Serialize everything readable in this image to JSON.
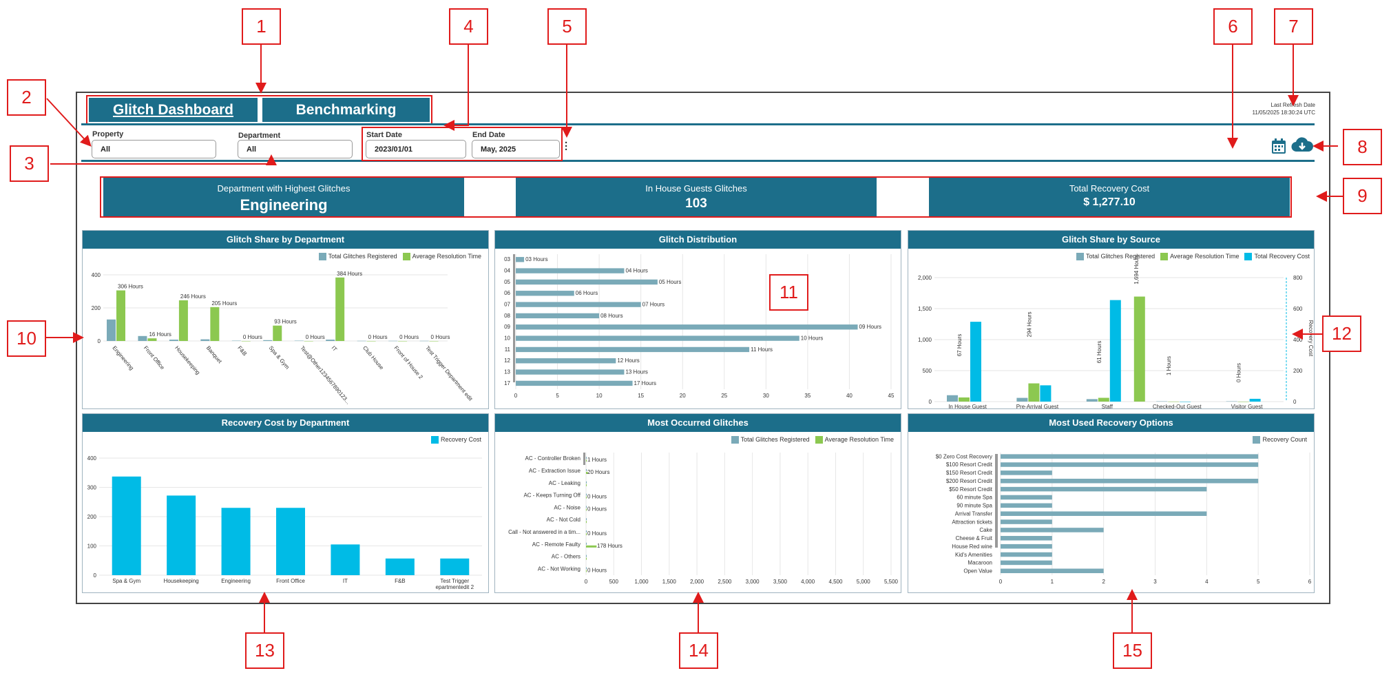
{
  "tabs": {
    "glitch_dashboard": "Glitch Dashboard",
    "benchmarking": "Benchmarking"
  },
  "filters": {
    "property_label": "Property",
    "property_value": "All",
    "department_label": "Department",
    "department_value": "All",
    "start_label": "Start Date",
    "start_value": "2023/01/01",
    "end_label": "End Date",
    "end_value": "May, 2025"
  },
  "refresh": {
    "label": "Last Refresh Date",
    "value": "11/05/2025 18:30:24 UTC"
  },
  "icons": {
    "calendar": "calendar-icon",
    "download": "cloud-download-icon",
    "more": "kebab-menu-icon"
  },
  "kpis": [
    {
      "title": "Department with Highest Glitches",
      "value": "Engineering"
    },
    {
      "title": "In House Guests Glitches",
      "value": "103"
    },
    {
      "title": "Total Recovery Cost",
      "value": "$ 1,277.10"
    }
  ],
  "callouts": [
    "1",
    "2",
    "3",
    "4",
    "5",
    "6",
    "7",
    "8",
    "9",
    "10",
    "11",
    "12",
    "13",
    "14",
    "15"
  ],
  "colors": {
    "header": "#1c6e8a",
    "series_total": "#7aaab8",
    "series_avg": "#8cc850",
    "series_cost": "#00bbe6",
    "callout": "#e01b1b"
  },
  "panels": {
    "dept_share": "Glitch Share by Department",
    "distribution": "Glitch Distribution",
    "source_share": "Glitch Share by Source",
    "recovery_cost": "Recovery Cost by Department",
    "most_occurred": "Most Occurred Glitches",
    "recovery_options": "Most Used Recovery Options"
  },
  "chart_data": [
    {
      "type": "bar",
      "title": "Glitch Share by Department",
      "categories": [
        "Engineering",
        "Front Office",
        "Housekeeping",
        "Banquet",
        "F&B",
        "Spa & Gym",
        "Test@Other1234567890123...",
        "IT",
        "Club House",
        "Front of House 2",
        "Test Trigger Department edit"
      ],
      "series": [
        {
          "name": "Total Glitches Registered",
          "values": [
            130,
            30,
            8,
            10,
            2,
            5,
            2,
            8,
            1,
            1,
            1
          ]
        },
        {
          "name": "Average Resolution Time",
          "values": [
            306,
            16,
            246,
            205,
            0,
            93,
            0,
            384,
            0,
            0,
            0
          ]
        }
      ],
      "data_labels": [
        "306 Hours",
        "16 Hours",
        "246 Hours",
        "205 Hours",
        "0 Hours",
        "93 Hours",
        "0 Hours",
        "384 Hours",
        "0 Hours",
        "0 Hours",
        "0 Hours"
      ],
      "ylim": [
        0,
        400
      ],
      "yticks": [
        "0",
        "200",
        "400"
      ],
      "legend": "top-right"
    },
    {
      "type": "bar",
      "orientation": "horizontal",
      "title": "Glitch Distribution",
      "categories": [
        "03",
        "04",
        "05",
        "06",
        "07",
        "08",
        "09",
        "10",
        "11",
        "12",
        "13",
        "17"
      ],
      "values": [
        1,
        13,
        17,
        7,
        15,
        10,
        41,
        34,
        28,
        12,
        13,
        14
      ],
      "data_labels": [
        "03 Hours",
        "04 Hours",
        "05 Hours",
        "06 Hours",
        "07 Hours",
        "08 Hours",
        "09 Hours",
        "10 Hours",
        "11 Hours",
        "12 Hours",
        "13 Hours",
        "17 Hours"
      ],
      "xlim": [
        0,
        45
      ],
      "xticks": [
        "0",
        "5",
        "10",
        "15",
        "20",
        "25",
        "30",
        "35",
        "40",
        "45"
      ]
    },
    {
      "type": "bar",
      "title": "Glitch Share by Source",
      "categories": [
        "In House Guest",
        "Pre-Arrival Guest",
        "Staff",
        "Checked-Out Guest",
        "Visitor Guest"
      ],
      "series": [
        {
          "name": "Total Glitches Registered",
          "values": [
            103,
            60,
            40,
            5,
            5
          ]
        },
        {
          "name": "Average Resolution Time",
          "values": [
            67,
            294,
            61,
            1,
            0
          ]
        },
        {
          "name": "Total Recovery Cost",
          "values": [
            515,
            105,
            655,
            0,
            18
          ]
        }
      ],
      "data_labels": [
        "67 Hours",
        "294 Hours",
        "61 Hours",
        "1,694 Hours",
        "1 Hours",
        "0 Hours"
      ],
      "ylim": [
        0,
        2000
      ],
      "yticks": [
        "0",
        "500",
        "1,000",
        "1,500",
        "2,000"
      ],
      "y2lim": [
        0,
        800
      ],
      "y2ticks": [
        "0",
        "200",
        "400",
        "600",
        "800"
      ],
      "y2label": "Recovery Cost",
      "legend": "top-right"
    },
    {
      "type": "bar",
      "title": "Recovery Cost by Department",
      "categories": [
        "Spa & Gym",
        "Housekeeping",
        "Engineering",
        "Front Office",
        "IT",
        "F&B",
        "Test Trigger Departmentedit 2"
      ],
      "series": [
        {
          "name": "Recovery Cost",
          "values": [
            337,
            272,
            230,
            230,
            105,
            57,
            57
          ]
        }
      ],
      "ylim": [
        0,
        400
      ],
      "yticks": [
        "0",
        "100",
        "200",
        "300",
        "400"
      ],
      "legend": "top-right"
    },
    {
      "type": "bar",
      "orientation": "horizontal",
      "title": "Most Occurred Glitches",
      "categories": [
        "AC - Controller Broken",
        "AC - Extraction Issue",
        "AC - Leaking",
        "AC - Keeps Turning Off",
        "AC - Noise",
        "AC - Not Cold",
        "Call - Not answered in a tim...",
        "AC - Remote Faulty",
        "AC - Others",
        "AC - Not Working"
      ],
      "series": [
        {
          "name": "Total Glitches Registered",
          "values": [
            2,
            1,
            1,
            1,
            1,
            1,
            1,
            1,
            1,
            1
          ]
        },
        {
          "name": "Average Resolution Time",
          "values": [
            1,
            20,
            0,
            0,
            0,
            0,
            0,
            178,
            0,
            0
          ]
        }
      ],
      "data_labels": [
        "1 Hours",
        "20 Hours",
        "0 Hours",
        "0 Hours",
        "0 Hours",
        "178 Hours",
        "0 Hours"
      ],
      "xlim": [
        0,
        5500
      ],
      "xticks": [
        "0",
        "500",
        "1,000",
        "1,500",
        "2,000",
        "2,500",
        "3,000",
        "3,500",
        "4,000",
        "4,500",
        "5,000",
        "5,500"
      ],
      "legend": "top-right"
    },
    {
      "type": "bar",
      "orientation": "horizontal",
      "title": "Most Used Recovery Options",
      "categories": [
        "$0 Zero Cost Recovery",
        "$100 Resort Credit",
        "$150 Resort Credit",
        "$200 Resort Credit",
        "$50 Resort Credit",
        "60 minute Spa",
        "90 minute Spa",
        "Arrival Transfer",
        "Attraction tickets",
        "Cake",
        "Cheese & Fruit",
        "House Red wine",
        "Kid's Amenities",
        "Macaroon",
        "Open Value"
      ],
      "series": [
        {
          "name": "Recovery Count",
          "values": [
            5,
            5,
            1,
            5,
            4,
            1,
            1,
            4,
            1,
            2,
            1,
            1,
            1,
            1,
            2
          ]
        }
      ],
      "xlim": [
        0,
        6
      ],
      "xticks": [
        "0",
        "1",
        "2",
        "3",
        "4",
        "5",
        "6"
      ],
      "legend": "top-right"
    }
  ]
}
